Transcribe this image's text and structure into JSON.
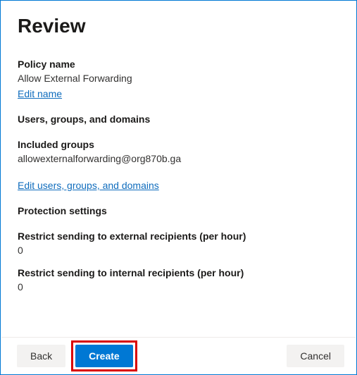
{
  "title": "Review",
  "policy": {
    "name_label": "Policy name",
    "name_value": "Allow External Forwarding",
    "edit_name_link": "Edit name"
  },
  "ugd": {
    "heading": "Users, groups, and domains",
    "included_label": "Included groups",
    "included_value": "allowexternalforwarding@org870b.ga",
    "edit_link": "Edit users, groups, and domains"
  },
  "protection": {
    "heading": "Protection settings",
    "ext_label": "Restrict sending to external recipients (per hour)",
    "ext_value": "0",
    "int_label": "Restrict sending to internal recipients (per hour)",
    "int_value": "0"
  },
  "footer": {
    "back": "Back",
    "create": "Create",
    "cancel": "Cancel"
  }
}
